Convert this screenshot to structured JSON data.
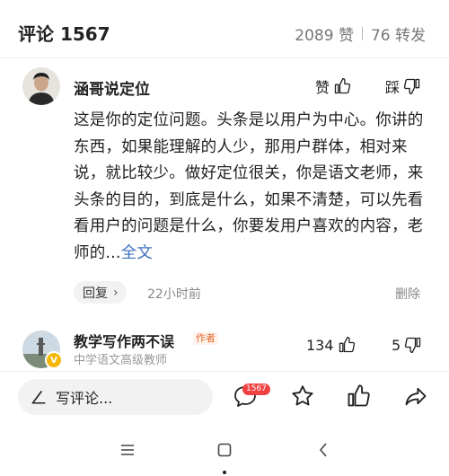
{
  "header": {
    "title": "评论 1567",
    "likes": "2089 赞",
    "shares": "76 转发"
  },
  "comment": {
    "username": "涵哥说定位",
    "like_label": "赞",
    "dislike_label": "踩",
    "body": "这是你的定位问题。头条是以用户为中心。你讲的东西，如果能理解的人少，那用户群体，相对来说，就比较少。做好定位很关，你是语文老师，来头条的目的，到底是什么，如果不清楚，可以先看看用户的问题是什么，你要发用户喜欢的内容，老师的...",
    "more_label": "全文",
    "reply_label": "回复",
    "time": "22小时前",
    "delete_label": "删除"
  },
  "second_comment": {
    "username": "教学写作两不误",
    "author_tag": "作者",
    "subtitle": "中学语文高级教师",
    "likes": "134",
    "dislikes": "5"
  },
  "bottom_bar": {
    "write_placeholder": "写评论...",
    "comment_count_badge": "1567"
  },
  "colors": {
    "accent_link": "#3b6fbd",
    "badge_red": "#f04142",
    "author_tag": "#e06a2c"
  }
}
